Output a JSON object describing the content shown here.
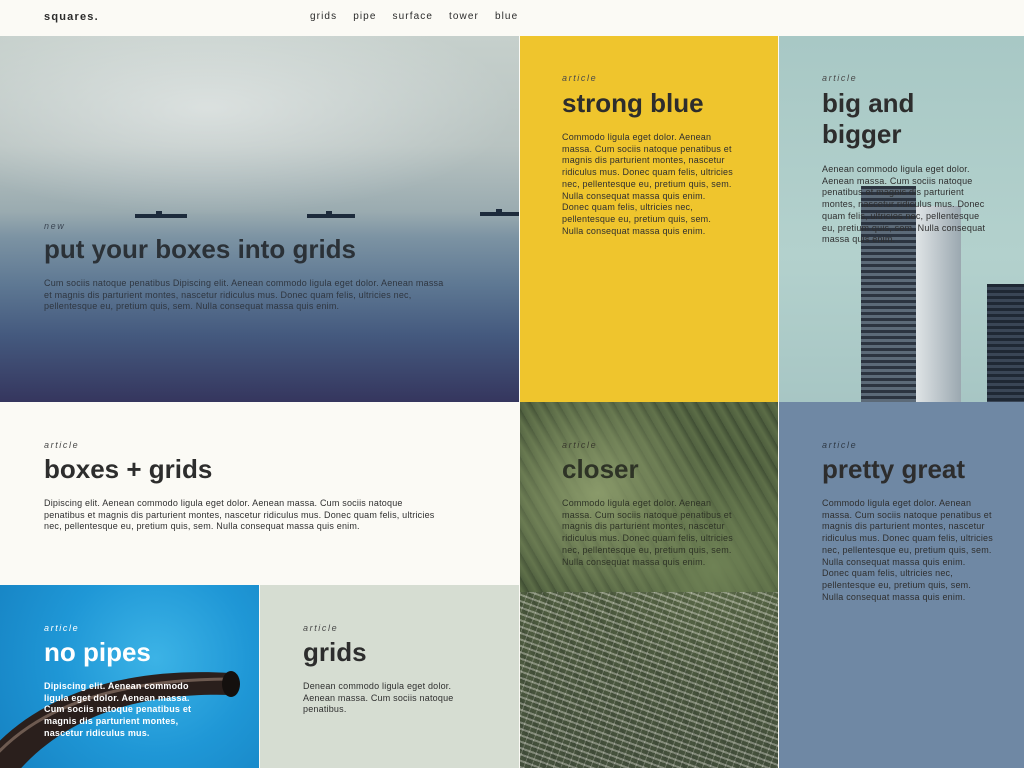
{
  "header": {
    "logo": "squares.",
    "nav": [
      "grids",
      "pipe",
      "surface",
      "tower",
      "blue"
    ]
  },
  "tiles": {
    "hero": {
      "label": "new",
      "title": "put your boxes into grids",
      "body": "Cum sociis natoque penatibus Dipiscing elit. Aenean commodo ligula eget dolor. Aenean massa et magnis dis parturient montes, nascetur ridiculus mus. Donec quam felis, ultricies nec, pellentesque eu, pretium quis, sem. Nulla consequat massa quis enim."
    },
    "yellow": {
      "label": "article",
      "title": "strong blue",
      "body": "Commodo ligula eget dolor. Aenean massa. Cum sociis natoque penatibus et magnis dis parturient montes, nascetur ridiculus mus. Donec quam felis, ultricies nec, pellentesque eu, pretium quis, sem. Nulla consequat massa quis enim.  Donec quam felis, ultricies nec, pellentesque eu, pretium quis, sem. Nulla consequat massa quis enim."
    },
    "tower": {
      "label": "article",
      "title": "big and bigger",
      "body": "Aenean commodo ligula eget dolor. Aenean massa. Cum sociis natoque penatibus et magnis dis parturient montes, nascetur ridiculus mus. Donec quam felis, ultricies nec, pellentesque eu, pretium quis, sem. Nulla consequat massa quis enim."
    },
    "boxes": {
      "label": "article",
      "title": "boxes + grids",
      "body": "Dipiscing elit. Aenean commodo ligula eget dolor. Aenean massa. Cum sociis natoque penatibus et magnis dis parturient montes, nascetur ridiculus mus. Donec quam felis, ultricies nec, pellentesque eu, pretium quis, sem. Nulla consequat massa quis enim."
    },
    "aerial": {
      "label": "article",
      "title": "closer",
      "body": "Commodo ligula eget dolor. Aenean massa. Cum sociis natoque penatibus et magnis dis parturient montes, nascetur ridiculus mus. Donec quam felis, ultricies nec, pellentesque eu, pretium quis, sem. Nulla consequat massa quis enim."
    },
    "pretty": {
      "label": "article",
      "title": "pretty great",
      "body": "Commodo ligula eget dolor. Aenean massa. Cum sociis natoque penatibus et magnis dis parturient montes, nascetur ridiculus mus. Donec quam felis, ultricies nec, pellentesque eu, pretium quis, sem. Nulla consequat massa quis enim.  Donec quam felis, ultricies nec, pellentesque eu, pretium quis, sem. Nulla consequat massa quis enim."
    },
    "pipes": {
      "label": "article",
      "title": "no pipes",
      "body": "Dipiscing elit. Aenean commodo ligula eget dolor. Aenean massa. Cum sociis natoque penatibus et magnis dis parturient montes, nascetur ridiculus mus."
    },
    "grids": {
      "label": "article",
      "title": "grids",
      "body": "Denean commodo ligula eget dolor. Aenean massa. Cum sociis natoque penatibus."
    }
  },
  "colors": {
    "yellow": "#efc52d",
    "slate": "#6f88a4",
    "sage": "#d6ddd2",
    "sky_blue": "#1f97d6",
    "background": "#fbfaf5"
  }
}
